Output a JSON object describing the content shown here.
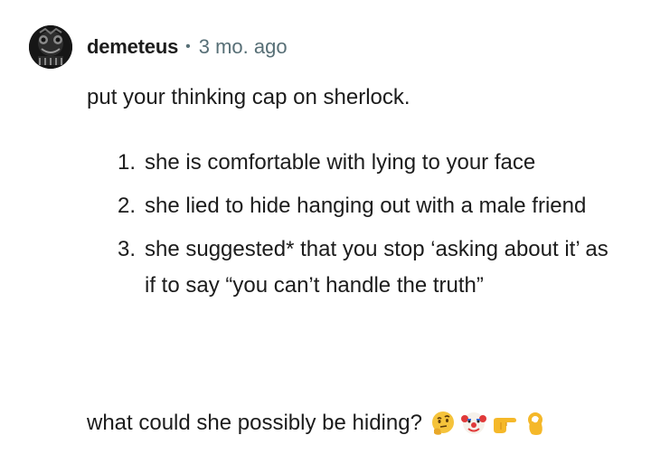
{
  "comment": {
    "author": "demeteus",
    "separator": "•",
    "age": "3 mo. ago",
    "intro": "put your thinking cap on sherlock.",
    "points": [
      {
        "num": "1.",
        "text": "she is comfortable with lying to your face"
      },
      {
        "num": "2.",
        "text": "she lied to hide hanging out with a male friend"
      },
      {
        "num": "3.",
        "text": "she suggested* that you stop ‘asking about it’ as if to say “you can’t handle the truth”"
      }
    ],
    "closing": "what could she possibly be hiding?",
    "emojis": [
      "thinking-face-icon",
      "clown-face-icon",
      "pointing-right-icon",
      "ok-hand-icon"
    ]
  },
  "colors": {
    "text": "#1c1c1c",
    "meta": "#576f76",
    "emoji_yellow": "#f5c33b"
  }
}
